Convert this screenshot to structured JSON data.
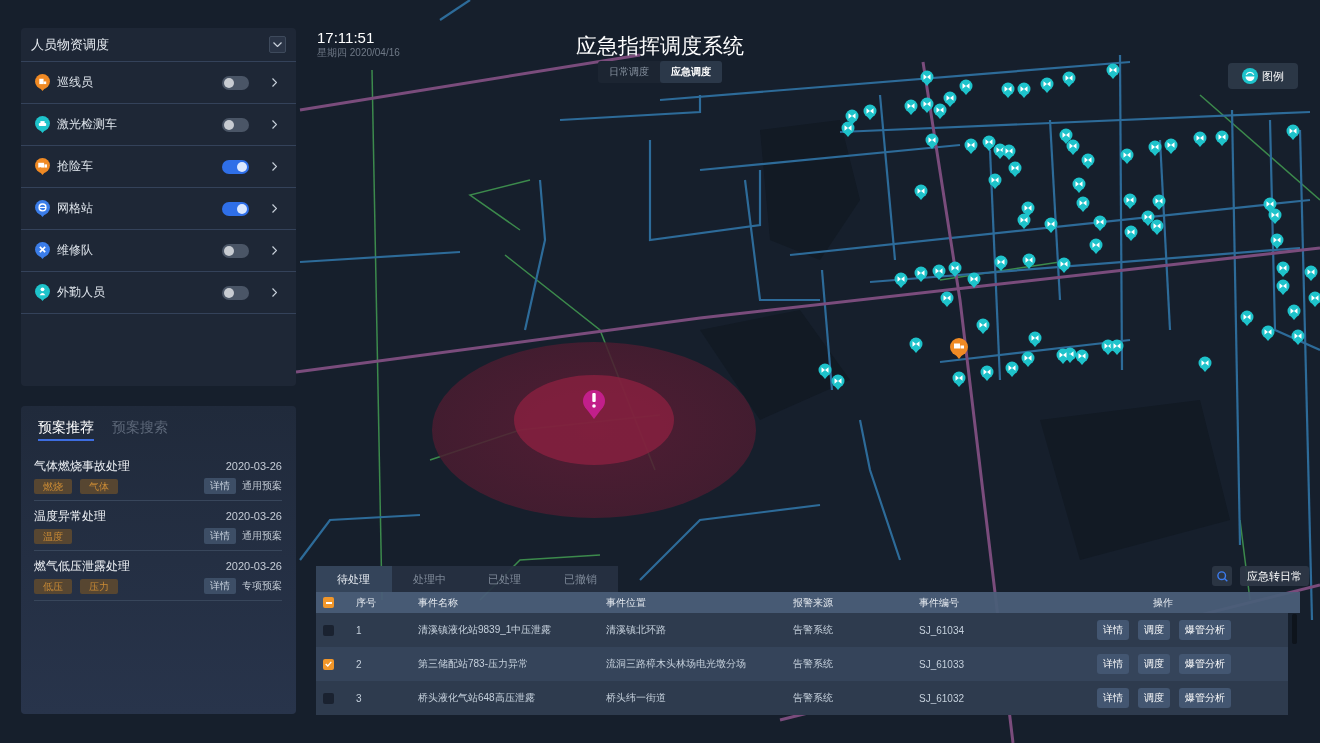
{
  "clock": {
    "time": "17:11:51",
    "date": "星期四 2020/04/16"
  },
  "header": {
    "title": "应急指挥调度系统",
    "modes": [
      {
        "label": "日常调度",
        "selected": false
      },
      {
        "label": "应急调度",
        "selected": true
      }
    ]
  },
  "legend_button": {
    "label": "图例"
  },
  "resource_panel": {
    "title": "人员物资调度",
    "items": [
      {
        "label": "巡线员",
        "color": "#f08a24",
        "on": false
      },
      {
        "label": "激光检测车",
        "color": "#1ec3cb",
        "on": false
      },
      {
        "label": "抢险车",
        "color": "#f08a24",
        "on": true
      },
      {
        "label": "网格站",
        "color": "#3b7de9",
        "on": true
      },
      {
        "label": "维修队",
        "color": "#3b7de9",
        "on": false
      },
      {
        "label": "外勤人员",
        "color": "#1ec3cb",
        "on": false
      }
    ]
  },
  "plan_panel": {
    "tabs": [
      {
        "label": "预案推荐",
        "selected": true
      },
      {
        "label": "预案搜索",
        "selected": false
      }
    ],
    "plans": [
      {
        "title": "气体燃烧事故处理",
        "date": "2020-03-26",
        "tags": [
          "燃烧",
          "气体"
        ],
        "button": "详情",
        "type": "通用预案"
      },
      {
        "title": "温度异常处理",
        "date": "2020-03-26",
        "tags": [
          "温度"
        ],
        "button": "详情",
        "type": "通用预案"
      },
      {
        "title": "燃气低压泄露处理",
        "date": "2020-03-26",
        "tags": [
          "低压",
          "压力"
        ],
        "button": "详情",
        "type": "专项预案"
      }
    ]
  },
  "map_controls": {
    "switch_button": "应急转日常"
  },
  "events": {
    "tabs": [
      {
        "label": "待处理",
        "selected": true
      },
      {
        "label": "处理中",
        "selected": false
      },
      {
        "label": "已处理",
        "selected": false
      },
      {
        "label": "已撤销",
        "selected": false
      }
    ],
    "select_all": {
      "indeterminate": true
    },
    "columns": [
      "序号",
      "事件名称",
      "事件位置",
      "报警来源",
      "事件编号",
      "操作"
    ],
    "rows": [
      {
        "checked": false,
        "no": "1",
        "name": "清溪镇液化站9839_1中压泄露",
        "location": "清溪镇北环路",
        "source": "告警系统",
        "id": "SJ_61034",
        "actions": [
          "详情",
          "调度",
          "爆管分析"
        ]
      },
      {
        "checked": true,
        "no": "2",
        "name": "第三储配站783-压力异常",
        "location": "流洞三路樟木头林场电光墩分场",
        "source": "告警系统",
        "id": "SJ_61033",
        "actions": [
          "详情",
          "调度",
          "爆管分析"
        ]
      },
      {
        "checked": false,
        "no": "3",
        "name": "桥头液化气站648高压泄露",
        "location": "桥头纬一街道",
        "source": "告警系统",
        "id": "SJ_61032",
        "actions": [
          "详情",
          "调度",
          "爆管分析"
        ]
      }
    ]
  }
}
